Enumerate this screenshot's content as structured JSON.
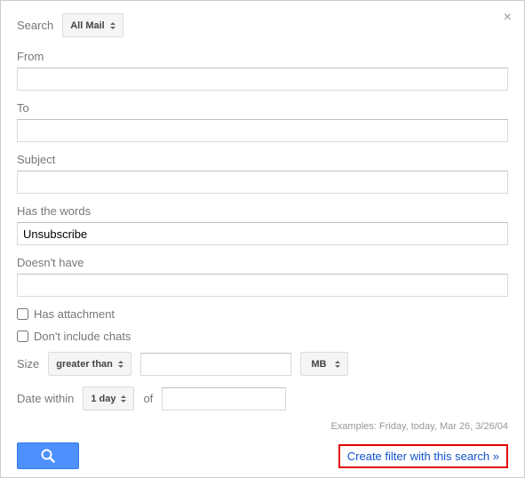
{
  "header": {
    "search_label": "Search",
    "scope": "All Mail"
  },
  "fields": {
    "from": {
      "label": "From",
      "value": ""
    },
    "to": {
      "label": "To",
      "value": ""
    },
    "subject": {
      "label": "Subject",
      "value": ""
    },
    "has_words": {
      "label": "Has the words",
      "value": "Unsubscribe"
    },
    "doesnt_have": {
      "label": "Doesn't have",
      "value": ""
    }
  },
  "checkboxes": {
    "has_attachment": {
      "label": "Has attachment",
      "checked": false
    },
    "dont_include_chats": {
      "label": "Don't include chats",
      "checked": false
    }
  },
  "size": {
    "label": "Size",
    "comparator": "greater than",
    "value": "",
    "unit": "MB"
  },
  "date": {
    "label": "Date within",
    "range": "1 day",
    "of_label": "of",
    "value": ""
  },
  "examples_text": "Examples: Friday, today, Mar 26, 3/26/04",
  "footer": {
    "create_filter_text": "Create filter with this search »"
  }
}
